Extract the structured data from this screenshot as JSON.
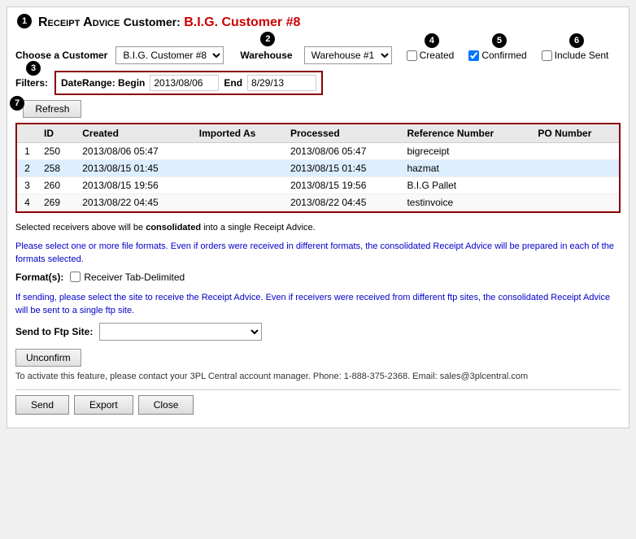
{
  "page": {
    "title_prefix": "Receipt Advice",
    "title_customer_label": "Customer:",
    "title_customer_name": "B.I.G. Customer #8"
  },
  "customer_selector": {
    "label": "Choose a Customer",
    "value": "B.I.G. Customer #8",
    "options": [
      "B.I.G. Customer #8"
    ]
  },
  "warehouse_selector": {
    "label": "Warehouse",
    "value": "Warehouse #1",
    "options": [
      "Warehouse #1"
    ]
  },
  "filters": {
    "label": "Filters:",
    "date_range_label": "DateRange: Begin",
    "begin_value": "2013/08/06",
    "end_label": "End",
    "end_value": "8/29/13"
  },
  "checkboxes": {
    "created_label": "Created",
    "created_checked": false,
    "confirmed_label": "Confirmed",
    "confirmed_checked": true,
    "include_sent_label": "Include Sent",
    "include_sent_checked": false
  },
  "refresh_button": "Refresh",
  "table": {
    "columns": [
      "",
      "ID",
      "Created",
      "Imported As",
      "Processed",
      "Reference Number",
      "PO Number"
    ],
    "rows": [
      {
        "num": "1",
        "id": "250",
        "created": "2013/08/06 05:47",
        "imported_as": "",
        "processed": "2013/08/06 05:47",
        "reference": "bigreceipt",
        "po": ""
      },
      {
        "num": "2",
        "id": "258",
        "created": "2013/08/15 01:45",
        "imported_as": "",
        "processed": "2013/08/15 01:45",
        "reference": "hazmat",
        "po": ""
      },
      {
        "num": "3",
        "id": "260",
        "created": "2013/08/15 19:56",
        "imported_as": "",
        "processed": "2013/08/15 19:56",
        "reference": "B.I.G Pallet",
        "po": ""
      },
      {
        "num": "4",
        "id": "269",
        "created": "2013/08/22 04:45",
        "imported_as": "",
        "processed": "2013/08/22 04:45",
        "reference": "testinvoice",
        "po": ""
      }
    ]
  },
  "info_texts": {
    "line1": "Selected receivers above will be consolidated into a single Receipt Advice.",
    "line2": "Please select one or more file formats. Even if orders were received in different formats, the consolidated Receipt Advice will be prepared in each of the formats selected.",
    "line3": "If sending, please select the site to receive the Receipt Advice. Even if receivers were received from different ftp sites, the consolidated Receipt Advice will be sent to a single ftp site."
  },
  "formats": {
    "label": "Format(s):",
    "option_label": "Receiver Tab-Delimited",
    "checked": false
  },
  "ftp": {
    "label": "Send to Ftp Site:",
    "value": "",
    "options": []
  },
  "buttons": {
    "unconfirm": "Unconfirm",
    "activation_text": "To activate this feature, please contact your 3PL Central account manager. Phone: 1-888-375-2368. Email: sales@3plcentral.com",
    "send": "Send",
    "export": "Export",
    "close": "Close"
  }
}
